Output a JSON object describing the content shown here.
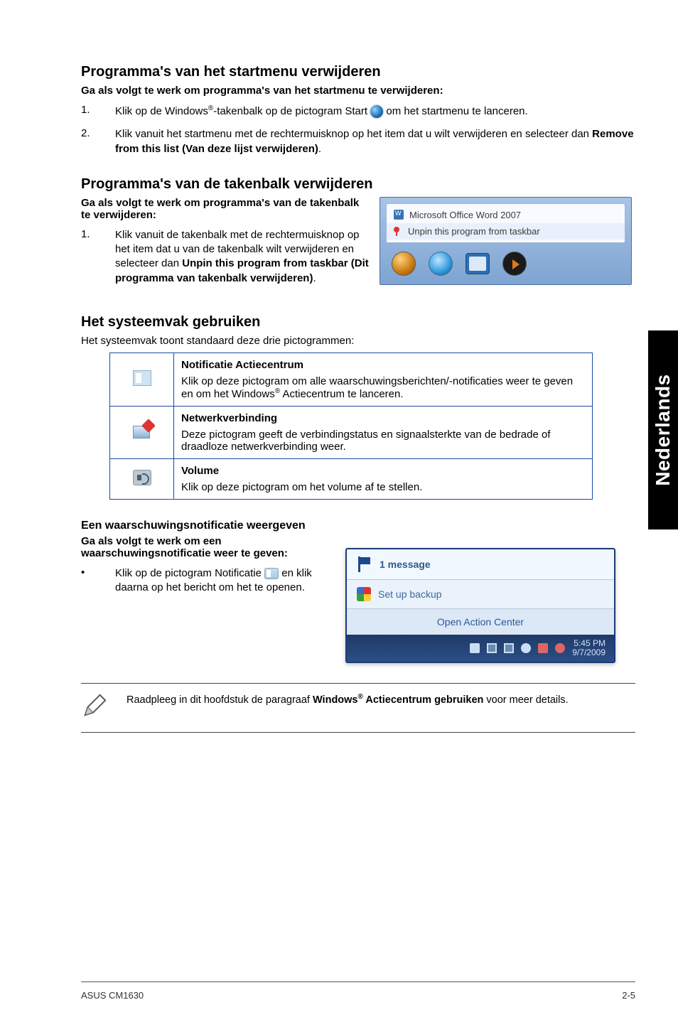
{
  "sideTab": "Nederlands",
  "section1": {
    "title": "Programma's van het startmenu verwijderen",
    "intro": "Ga als volgt te werk om programma's van het startmenu te verwijderen:",
    "steps": [
      {
        "n": "1.",
        "pre": "Klik op de Windows",
        "sup": "®",
        "mid": "-takenbalk op de pictogram Start ",
        "post": " om het startmenu te lanceren."
      },
      {
        "n": "2.",
        "text": "Klik vanuit het startmenu met de rechtermuisknop op het item dat u wilt verwijderen en selecteer dan ",
        "bold": "Remove from this list (Van deze lijst verwijderen)",
        "tail": "."
      }
    ]
  },
  "section2": {
    "title": "Programma's van de takenbalk verwijderen",
    "intro": "Ga als volgt te werk om programma's van de takenbalk te verwijderen:",
    "step": {
      "n": "1.",
      "text": "Klik vanuit de takenbalk met de rechtermuisknop op het item dat u van de takenbalk wilt verwijderen en selecteer dan ",
      "bold": "Unpin this program from taskbar (Dit programma van takenbalk verwijderen)",
      "tail": "."
    },
    "jumplist": {
      "item1": "Microsoft Office Word 2007",
      "item2": "Unpin this program from taskbar"
    }
  },
  "section3": {
    "title": "Het systeemvak gebruiken",
    "intro": "Het systeemvak toont standaard deze drie pictogrammen:",
    "rows": [
      {
        "title": "Notificatie Actiecentrum",
        "pre": "Klik op deze pictogram om alle waarschuwingsberichten/-notificaties weer te geven en om het Windows",
        "sup": "®",
        "post": " Actiecentrum te lanceren."
      },
      {
        "title": "Netwerkverbinding",
        "desc": "Deze pictogram geeft de verbindingstatus en signaalsterkte van de bedrade of draadloze netwerkverbinding weer."
      },
      {
        "title": "Volume",
        "desc": "Klik op deze pictogram om het volume af te stellen."
      }
    ]
  },
  "section4": {
    "title": "Een waarschuwingsnotificatie weergeven",
    "intro": "Ga als volgt te werk om een waarschuwingsnotificatie weer te geven:",
    "bullet": {
      "text1": "Klik op de pictogram Notificatie ",
      "text2": " en klik daarna op het bericht om het te openen."
    },
    "popup": {
      "msg": "1 message",
      "backup": "Set up backup",
      "open": "Open Action Center",
      "time": "5:45 PM",
      "date": "9/7/2009"
    }
  },
  "note": {
    "pre": "Raadpleeg in dit hoofdstuk de paragraaf ",
    "bold": "Windows",
    "sup": "®",
    "bold2": " Actiecentrum gebruiken",
    "post": " voor meer details."
  },
  "footer": {
    "left": "ASUS CM1630",
    "right": "2-5"
  }
}
